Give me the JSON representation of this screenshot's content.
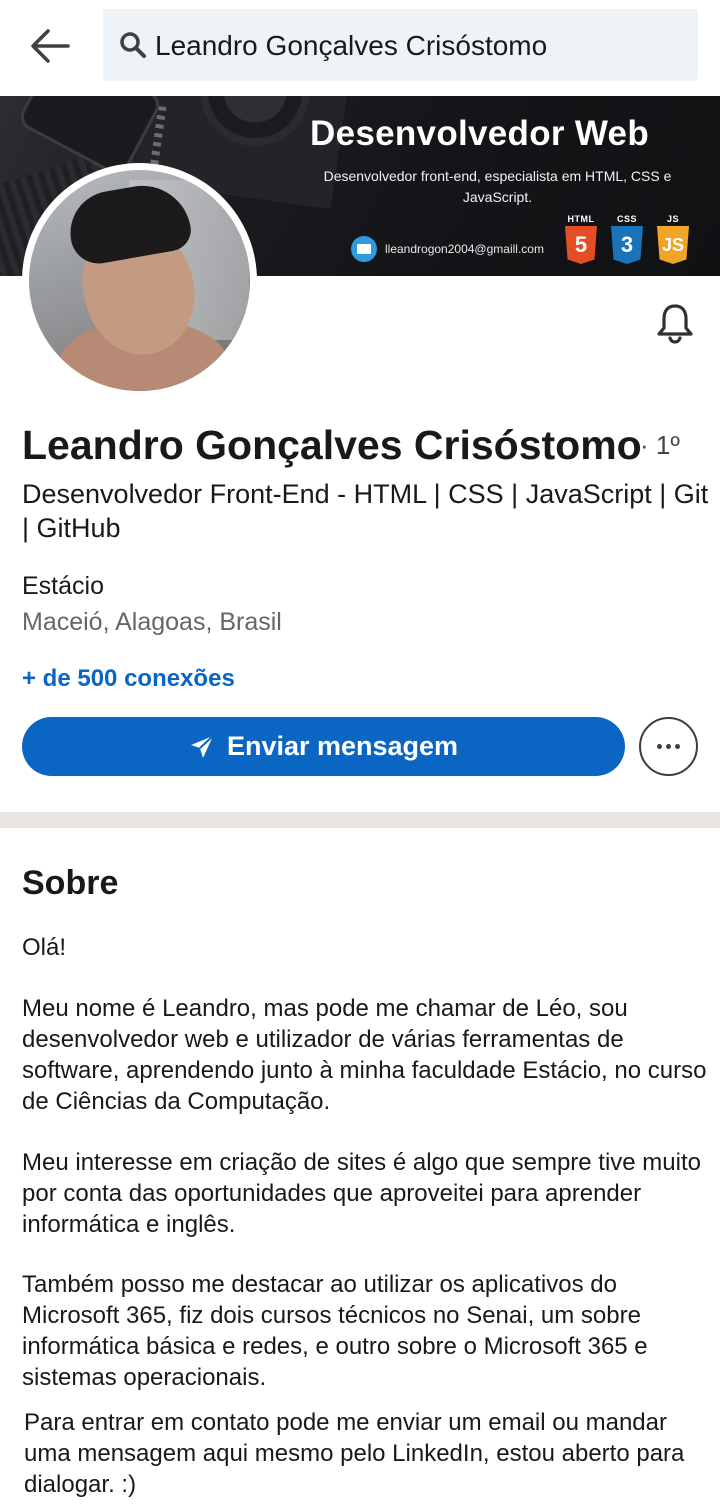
{
  "search": {
    "query": "Leandro Gonçalves Crisóstomo"
  },
  "banner": {
    "title": "Desenvolvedor Web",
    "subtitle": "Desenvolvedor front-end, especialista em HTML, CSS e JavaScript.",
    "email": "lleandrogon2004@gmaill.com",
    "tech": [
      {
        "label": "HTML",
        "glyph": "5",
        "color": "#e44d26"
      },
      {
        "label": "CSS",
        "glyph": "3",
        "color": "#1b73ba"
      },
      {
        "label": "JS",
        "glyph": "JS",
        "color": "#f0a526"
      }
    ]
  },
  "profile": {
    "name": "Leandro Gonçalves Crisóstomo",
    "degree": "· 1º",
    "headline": "Desenvolvedor Front-End - HTML | CSS | JavaScript | Git | GitHub",
    "education": "Estácio",
    "location": "Maceió, Alagoas, Brasil",
    "connections": "+ de 500 conexões"
  },
  "actions": {
    "message_label": "Enviar mensagem"
  },
  "about": {
    "title": "Sobre",
    "paragraphs": [
      "Olá!",
      "Meu nome é Leandro, mas pode me chamar de Léo, sou desenvolvedor web e utilizador de várias ferramentas de software, aprendendo junto à minha faculdade Estácio, no curso de Ciências da Computação.",
      "Meu interesse em criação de sites é algo que sempre tive muito por conta das oportunidades que aproveitei para aprender informática e inglês.",
      "Também posso me destacar ao utilizar os aplicativos do Microsoft 365, fiz dois cursos técnicos no Senai, um sobre informática básica e redes, e outro sobre o Microsoft 365 e sistemas operacionais.",
      "Para entrar em contato pode me enviar um email ou mandar uma mensagem aqui mesmo pelo LinkedIn, estou aberto para dialogar.  :)"
    ]
  },
  "colors": {
    "accent": "#0a66c2",
    "divider": "#e9e5df",
    "search_bg": "#eef3f8"
  }
}
